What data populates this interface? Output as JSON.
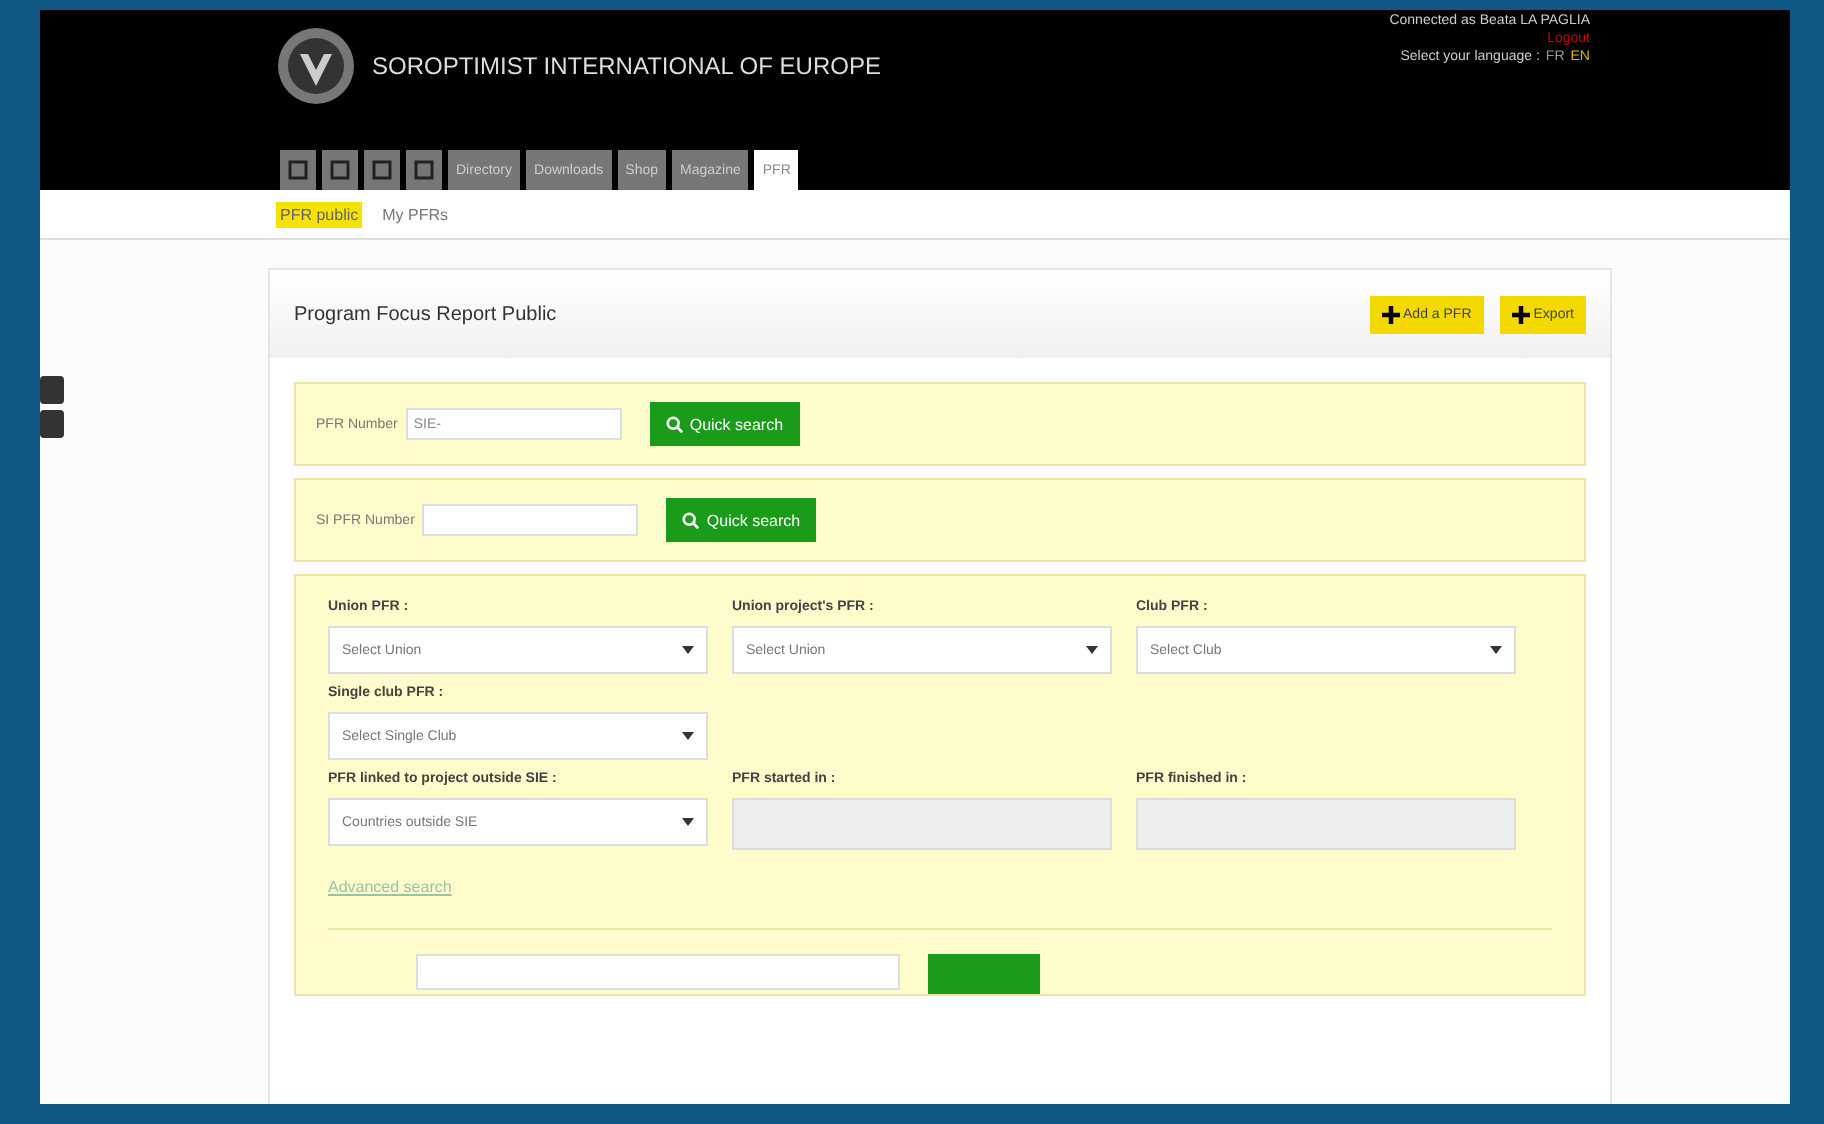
{
  "header": {
    "title": "SOROPTIMIST INTERNATIONAL OF EUROPE",
    "user": "Connected as Beata LA PAGLIA",
    "logout": "Logout",
    "language_label": "Select your language :",
    "languages": [
      {
        "label": "FR",
        "selected": false
      },
      {
        "label": "EN",
        "selected": true
      }
    ]
  },
  "nav_tabs": [
    {
      "kind": "icon",
      "selected": false
    },
    {
      "kind": "icon",
      "selected": false
    },
    {
      "kind": "icon",
      "selected": false
    },
    {
      "kind": "icon",
      "selected": false
    },
    {
      "kind": "text",
      "label": "Directory",
      "selected": false
    },
    {
      "kind": "text",
      "label": "Downloads",
      "selected": false
    },
    {
      "kind": "text",
      "label": "Shop",
      "selected": false
    },
    {
      "kind": "text",
      "label": "Magazine",
      "selected": false
    },
    {
      "kind": "text",
      "label": "PFR",
      "selected": true
    }
  ],
  "sub_tabs": [
    {
      "label": "PFR public",
      "selected": true
    },
    {
      "label": "My PFRs",
      "selected": false
    }
  ],
  "panel": {
    "title": "Program Focus Report Public",
    "buttons": [
      "Add a PFR",
      "Export"
    ],
    "quick_searches": [
      {
        "label": "PFR Number",
        "value": "SIE-",
        "button": "Quick search"
      },
      {
        "label": "SI PFR Number",
        "button": "Quick search"
      }
    ],
    "filters": [
      {
        "label": "Union PFR :",
        "kind": "select",
        "value": "Select Union"
      },
      {
        "label": "Union project's PFR :",
        "kind": "select",
        "value": "Select Union"
      },
      {
        "label": "Club PFR :",
        "kind": "select",
        "value": "Select Club"
      },
      {
        "label": "Single club PFR :",
        "kind": "select",
        "value": "Select Single Club"
      },
      {
        "kind": "break"
      },
      {
        "label": "PFR linked to project outside SIE :",
        "kind": "select",
        "value": "Countries outside SIE"
      },
      {
        "label": "PFR started in :",
        "kind": "date"
      },
      {
        "label": "PFR finished in :",
        "kind": "date"
      }
    ],
    "advanced_link": "Advanced search"
  }
}
